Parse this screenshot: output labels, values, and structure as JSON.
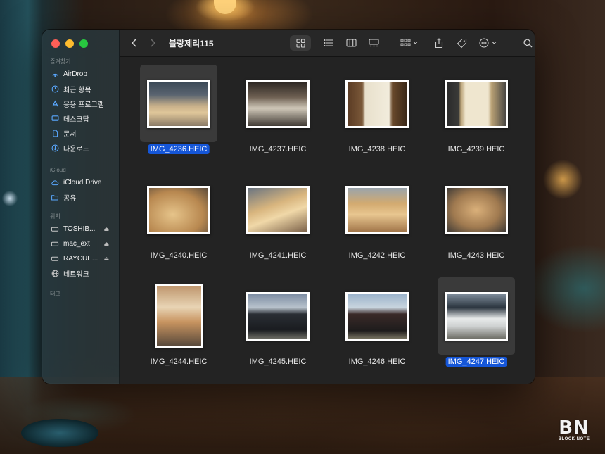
{
  "window": {
    "folder_title": "블랑제리115"
  },
  "sidebar": {
    "favorites_title": "즐겨찾기",
    "favorites": [
      {
        "label": "AirDrop",
        "icon": "airdrop-icon"
      },
      {
        "label": "최근 항목",
        "icon": "clock-icon"
      },
      {
        "label": "응용 프로그램",
        "icon": "applications-icon"
      },
      {
        "label": "데스크탑",
        "icon": "desktop-icon"
      },
      {
        "label": "문서",
        "icon": "document-icon"
      },
      {
        "label": "다운로드",
        "icon": "download-icon"
      }
    ],
    "icloud_title": "iCloud",
    "icloud": [
      {
        "label": "iCloud Drive",
        "icon": "cloud-icon"
      },
      {
        "label": "공유",
        "icon": "shared-folder-icon"
      }
    ],
    "locations_title": "위치",
    "locations": [
      {
        "label": "TOSHIB...",
        "icon": "drive-icon",
        "eject": true
      },
      {
        "label": "mac_ext",
        "icon": "drive-icon",
        "eject": true
      },
      {
        "label": "RAYCUE...",
        "icon": "drive-icon",
        "eject": true
      },
      {
        "label": "네트워크",
        "icon": "network-icon",
        "eject": false
      }
    ],
    "tags_title": "태그"
  },
  "files": [
    {
      "name": "IMG_4236.HEIC",
      "selected": true
    },
    {
      "name": "IMG_4237.HEIC",
      "selected": false
    },
    {
      "name": "IMG_4238.HEIC",
      "selected": false
    },
    {
      "name": "IMG_4239.HEIC",
      "selected": false
    },
    {
      "name": "IMG_4240.HEIC",
      "selected": false
    },
    {
      "name": "IMG_4241.HEIC",
      "selected": false
    },
    {
      "name": "IMG_4242.HEIC",
      "selected": false
    },
    {
      "name": "IMG_4243.HEIC",
      "selected": false
    },
    {
      "name": "IMG_4244.HEIC",
      "selected": false
    },
    {
      "name": "IMG_4245.HEIC",
      "selected": false
    },
    {
      "name": "IMG_4246.HEIC",
      "selected": false
    },
    {
      "name": "IMG_4247.HEIC",
      "selected": true
    }
  ],
  "watermark": {
    "letters": "BN",
    "sub": "BLOCK NOTE"
  },
  "colors": {
    "selection": "#1556d8",
    "accent": "#5aa8ff"
  }
}
